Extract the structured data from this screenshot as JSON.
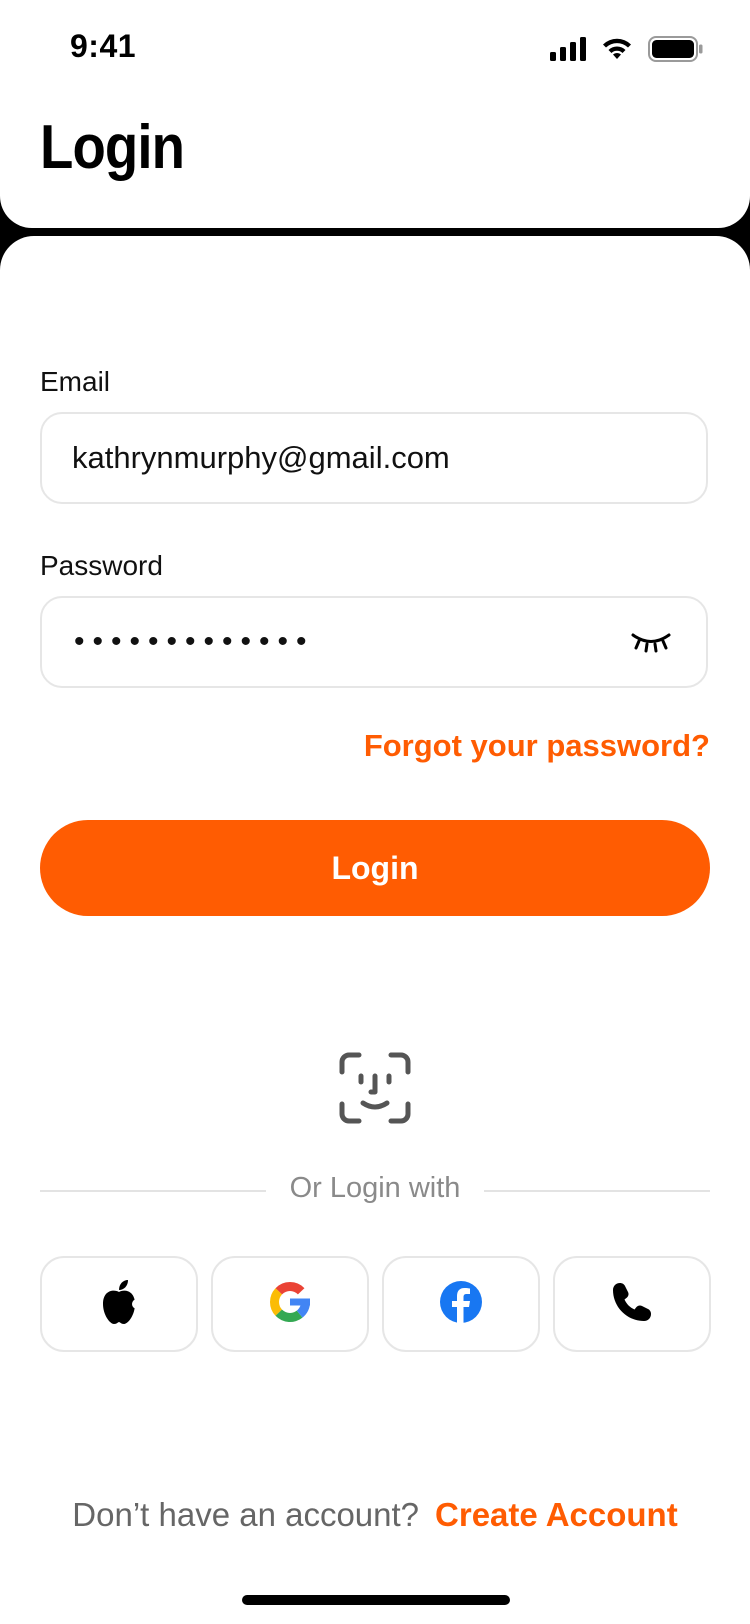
{
  "status_bar": {
    "time": "9:41",
    "icons": [
      "cellular-signal-icon",
      "wifi-icon",
      "battery-icon"
    ]
  },
  "header": {
    "title": "Login"
  },
  "form": {
    "email_label": "Email",
    "email_value": "kathrynmurphy@gmail.com",
    "password_label": "Password",
    "password_masked": "•••••••••••••",
    "password_toggle_icon": "eye-closed-icon",
    "forgot_label": "Forgot your password?",
    "login_label": "Login"
  },
  "biometric": {
    "icon": "face-id-icon"
  },
  "social": {
    "divider_label": "Or Login with",
    "providers": [
      {
        "name": "apple",
        "icon": "apple-icon"
      },
      {
        "name": "google",
        "icon": "google-icon"
      },
      {
        "name": "facebook",
        "icon": "facebook-icon"
      },
      {
        "name": "phone",
        "icon": "phone-icon"
      }
    ]
  },
  "footer": {
    "prompt": "Don’t have an account?",
    "link": "Create Account"
  },
  "colors": {
    "accent": "#ff5c02",
    "background": "#ffffff",
    "border": "#e6e6e6",
    "google_blue": "#4285F4",
    "google_red": "#EA4335",
    "google_yellow": "#FBBC05",
    "google_green": "#34A853",
    "facebook_blue": "#1877F2"
  }
}
